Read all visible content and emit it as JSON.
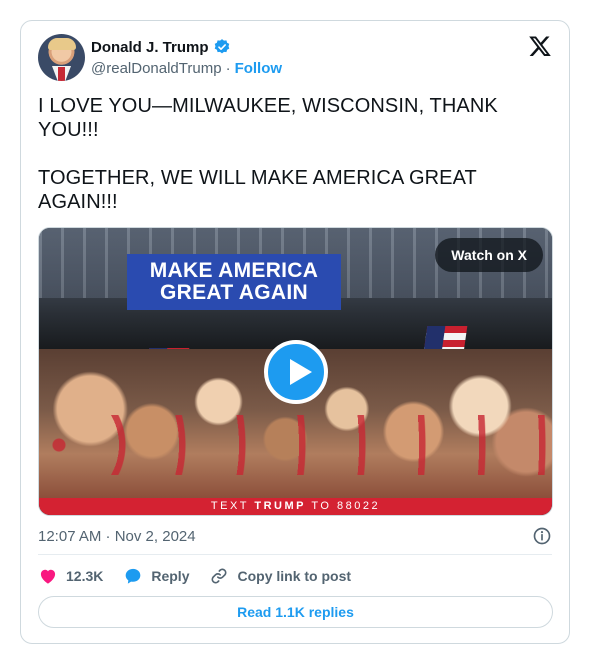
{
  "author": {
    "display_name": "Donald J. Trump",
    "handle": "@realDonaldTrump",
    "separator": "·",
    "follow_label": "Follow",
    "verified_color": "#1d9bf0"
  },
  "tweet": {
    "paragraphs": [
      "I LOVE YOU—MILWAUKEE, WISCONSIN, THANK YOU!!!",
      "TOGETHER, WE WILL MAKE AMERICA GREAT AGAIN!!!"
    ]
  },
  "media": {
    "watch_label": "Watch on X",
    "banner_line1": "MAKE AMERICA",
    "banner_line2": "GREAT AGAIN",
    "strip_prefix": "TEXT ",
    "strip_keyword": "TRUMP",
    "strip_suffix": " TO 88022"
  },
  "meta": {
    "timestamp": "12:07 AM · Nov 2, 2024"
  },
  "actions": {
    "like_count": "12.3K",
    "reply_label": "Reply",
    "copy_link_label": "Copy link to post"
  },
  "footer": {
    "read_replies_label": "Read 1.1K replies"
  },
  "colors": {
    "accent": "#1d9bf0",
    "like": "#f91880",
    "muted": "#536471",
    "text": "#0f1419"
  }
}
